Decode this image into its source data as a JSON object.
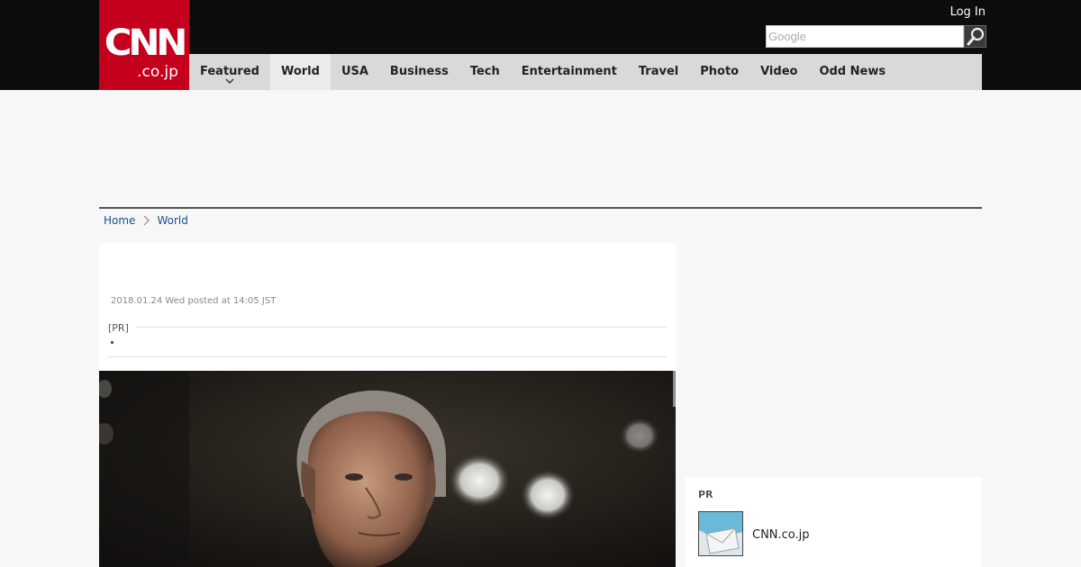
{
  "header": {
    "logo_main": "CNN",
    "logo_sub": ".co.jp",
    "login_label": "Log In",
    "search_placeholder": "Google"
  },
  "nav": {
    "items": [
      {
        "label": "Featured"
      },
      {
        "label": "World"
      },
      {
        "label": "USA"
      },
      {
        "label": "Business"
      },
      {
        "label": "Tech"
      },
      {
        "label": "Entertainment"
      },
      {
        "label": "Travel"
      },
      {
        "label": "Photo"
      },
      {
        "label": "Video"
      },
      {
        "label": "Odd News"
      }
    ],
    "active": "World"
  },
  "breadcrumb": {
    "home": "Home",
    "section": "World"
  },
  "article": {
    "date": "2018.01.24 Wed posted at 14:05 JST",
    "pr_label": "[PR]"
  },
  "sidebar": {
    "pr_title": "PR",
    "pr_site": "CNN.co.jp"
  },
  "colors": {
    "brand_red": "#c5001c",
    "header_bg": "#0c0c0c",
    "nav_bg": "#d9d9d9",
    "link": "#1a4e8a"
  }
}
